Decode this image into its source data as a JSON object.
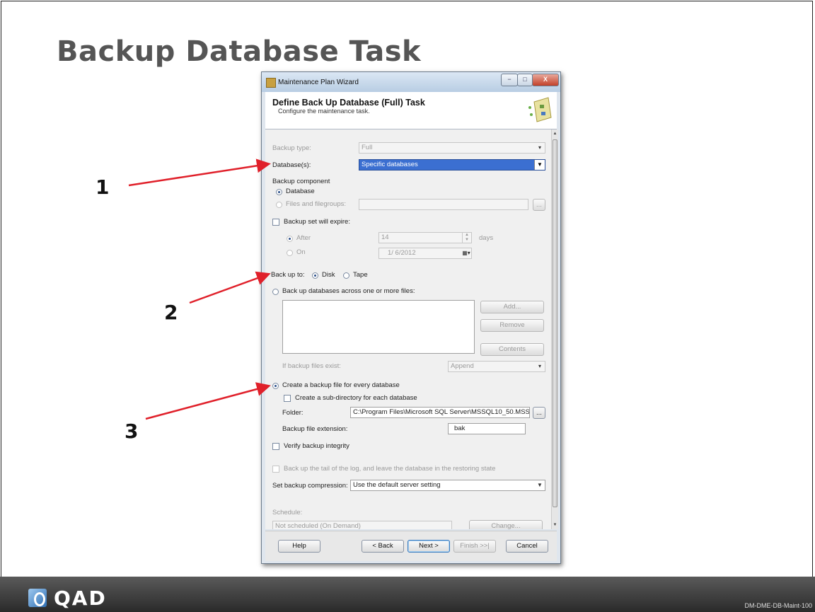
{
  "slide": {
    "title": "Backup Database Task",
    "footer_code": "DM-DME-DB-Maint-100",
    "logo_text": "QAD",
    "callouts": [
      "1",
      "2",
      "3"
    ],
    "arrow_color": "#e0202a"
  },
  "window": {
    "title": "Maintenance Plan Wizard",
    "minimize": "−",
    "maximize": "□",
    "close": "X"
  },
  "header": {
    "title": "Define Back Up Database (Full) Task",
    "subtitle": "Configure the maintenance task."
  },
  "form": {
    "backup_type_label": "Backup type:",
    "backup_type_value": "Full",
    "databases_label": "Database(s):",
    "databases_value": "Specific databases",
    "backup_component_label": "Backup component",
    "component_database": "Database",
    "component_files": "Files and filegroups:",
    "component_files_browse": "...",
    "expire_label": "Backup set will expire:",
    "expire_after": "After",
    "expire_after_value": "14",
    "expire_after_unit": "days",
    "expire_on": "On",
    "expire_on_value": "1/ 6/2012",
    "back_up_to_label": "Back up to:",
    "back_up_to_disk": "Disk",
    "back_up_to_tape": "Tape",
    "across_files_label": "Back up databases across one or more files:",
    "add_button": "Add...",
    "remove_button": "Remove",
    "contents_button": "Contents",
    "if_exist_label": "If backup files exist:",
    "if_exist_value": "Append",
    "per_db_label": "Create a backup file for every database",
    "subdir_label": "Create a sub-directory for each database",
    "folder_label": "Folder:",
    "folder_value": "C:\\Program Files\\Microsoft SQL Server\\MSSQL10_50.MSS(",
    "folder_browse": "...",
    "extension_label": "Backup file extension:",
    "extension_value": "bak",
    "verify_label": "Verify backup integrity",
    "tail_log_label": "Back up the tail of the log, and leave the database in the restoring state",
    "compression_label": "Set backup compression:",
    "compression_value": "Use the default server setting",
    "schedule_label": "Schedule:",
    "schedule_value": "Not scheduled (On Demand)",
    "change_button": "Change..."
  },
  "buttons": {
    "help": "Help",
    "back": "< Back",
    "next": "Next >",
    "finish": "Finish >>|",
    "cancel": "Cancel"
  }
}
